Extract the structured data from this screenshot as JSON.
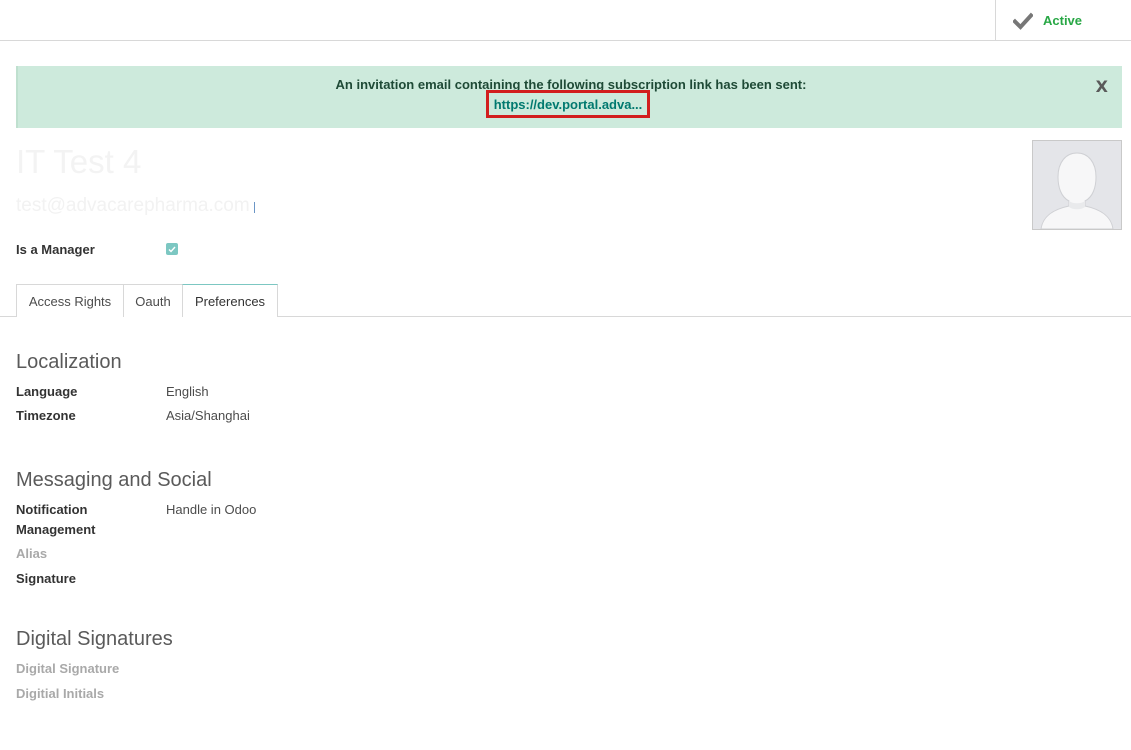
{
  "status": {
    "label": "Active",
    "icon": "check-icon",
    "color": "#28a745"
  },
  "alert": {
    "message": "An invitation email containing the following subscription link has been sent:",
    "link_text": "https://dev.portal.adva...",
    "close_label": "X"
  },
  "user": {
    "name": "IT Test 4",
    "email": "test@advacarepharma.com"
  },
  "manager": {
    "label": "Is a Manager",
    "checked": true
  },
  "tabs": [
    {
      "label": "Access Rights",
      "active": false
    },
    {
      "label": "Oauth",
      "active": false
    },
    {
      "label": "Preferences",
      "active": true
    }
  ],
  "localization": {
    "title": "Localization",
    "language_label": "Language",
    "language_value": "English",
    "timezone_label": "Timezone",
    "timezone_value": "Asia/Shanghai"
  },
  "messaging": {
    "title": "Messaging and Social",
    "notification_label_line1": "Notification",
    "notification_label_line2": "Management",
    "notification_value": "Handle in Odoo",
    "alias_label": "Alias",
    "signature_label": "Signature"
  },
  "digital": {
    "title": "Digital Signatures",
    "signature_label": "Digital Signature",
    "initials_label": "Digitial Initials"
  },
  "colors": {
    "accent": "#7cc7c2",
    "alert_bg": "#cdeadc",
    "highlight_border": "#d21e1e",
    "link": "#01796f"
  }
}
